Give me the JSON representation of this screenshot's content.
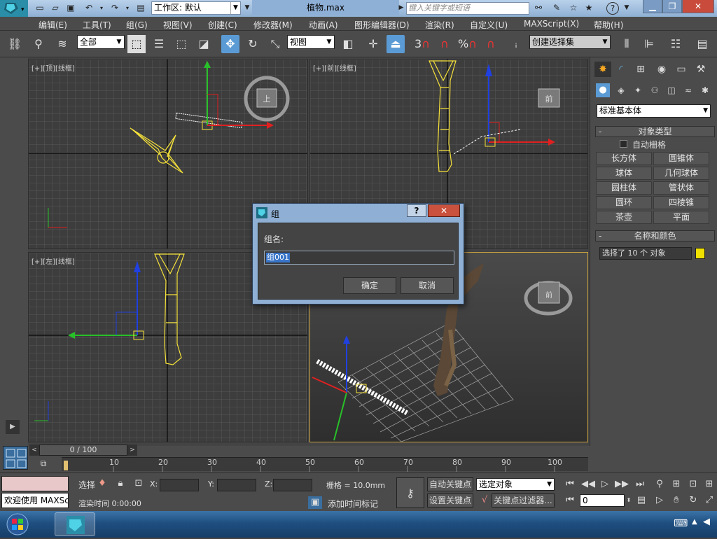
{
  "titlebar": {
    "workspace_label": "工作区: 默认",
    "file_title": "植物.max",
    "search_placeholder": "键入关键字或短语",
    "help_label": "?"
  },
  "menu": [
    "编辑(E)",
    "工具(T)",
    "组(G)",
    "视图(V)",
    "创建(C)",
    "修改器(M)",
    "动画(A)",
    "图形编辑器(D)",
    "渲染(R)",
    "自定义(U)",
    "MAXScript(X)",
    "帮助(H)"
  ],
  "toolbar": {
    "selection_filter": "全部",
    "reference_coord": "视图",
    "named_selection": "创建选择集",
    "snap_3": "3",
    "percent": "%"
  },
  "viewports": {
    "top": "[+][顶][线框]",
    "front": "[+][前][线框]",
    "left": "[+][左][线框]",
    "cube_top": "上",
    "cube_front": "前",
    "cube_persp": "前"
  },
  "panel": {
    "dropdown": "标准基本体",
    "object_type_title": "对象类型",
    "autogrid_label": "自动栅格",
    "buttons": [
      "长方体",
      "圆锥体",
      "球体",
      "几何球体",
      "圆柱体",
      "管状体",
      "圆环",
      "四棱锥",
      "茶壶",
      "平面"
    ],
    "name_color_title": "名称和颜色",
    "name_field": "选择了 10 个 对象",
    "name_swatch_color": "#f0e000",
    "minus": "-"
  },
  "dialog": {
    "title": "组",
    "label": "组名:",
    "value": "组001",
    "ok": "确定",
    "cancel": "取消",
    "help": "?",
    "close": "✕"
  },
  "timeline": {
    "frame": "0 / 100",
    "ticks": [
      "10",
      "20",
      "30",
      "40",
      "50",
      "60",
      "70",
      "80",
      "90",
      "100"
    ]
  },
  "status": {
    "maxscript": "欢迎使用 MAXSc",
    "select_label": "选择",
    "x_label": "X:",
    "y_label": "Y:",
    "z_label": "Z:",
    "grid": "栅格 = 10.0mm",
    "render_time": "渲染时间 0:00:00",
    "add_time_tag": "添加时间标记",
    "auto_key": "自动关键点",
    "set_key": "设置关键点",
    "selected_object": "选定对象",
    "key_filter": "关键点过滤器...",
    "frame_field": "0"
  }
}
